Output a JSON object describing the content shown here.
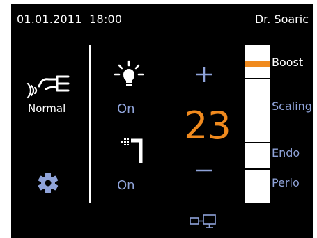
{
  "status_bar": {
    "datetime": "01.01.2011  18:00",
    "user": "Dr. Soaric"
  },
  "mode": {
    "icon": "ultrasound-handpiece-icon",
    "label": "Normal"
  },
  "settings": {
    "icon": "gear-icon"
  },
  "light": {
    "icon": "light-bulb-icon",
    "state": "On"
  },
  "water": {
    "icon": "water-spray-icon",
    "state": "On"
  },
  "power": {
    "value": "23",
    "level_fraction": 0.23
  },
  "scale": {
    "labels": {
      "boost": "Boost",
      "scaling": "Scaling",
      "endo": "Endo",
      "perio": "Perio"
    }
  },
  "display": {
    "icon": "screen-toggle-icon"
  },
  "colors": {
    "background": "#000000",
    "accent": "#f08a1e",
    "label_blue": "#8fa3d9",
    "foreground": "#ffffff"
  }
}
